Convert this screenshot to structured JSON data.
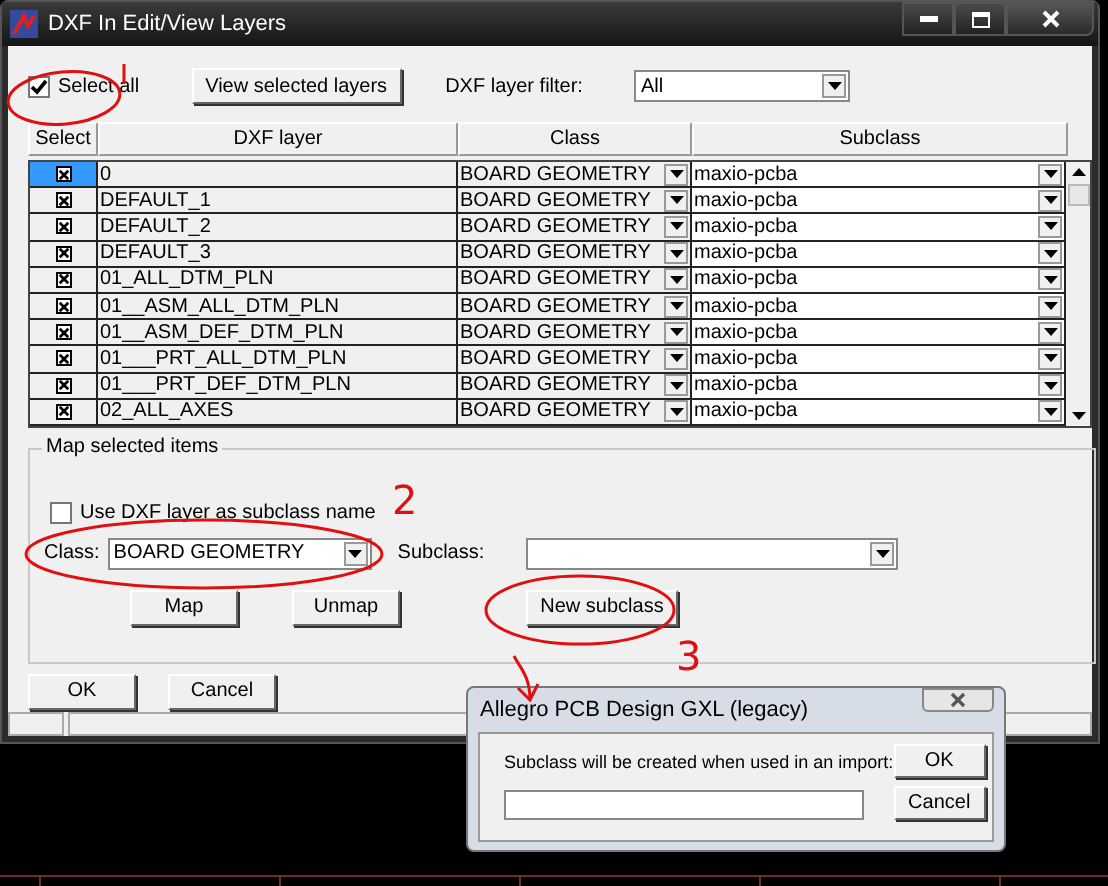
{
  "window": {
    "title": "DXF In Edit/View Layers"
  },
  "toolbar": {
    "select_all": {
      "label": "Select all",
      "checked": true
    },
    "view_button": "View selected layers",
    "filter_label": "DXF layer filter:",
    "filter_value": "All"
  },
  "table": {
    "columns": [
      "Select",
      "DXF layer",
      "Class",
      "Subclass"
    ],
    "rows": [
      {
        "selected": true,
        "checked": true,
        "layer": "0",
        "class": "BOARD GEOMETRY",
        "subclass": "maxio-pcba"
      },
      {
        "selected": false,
        "checked": true,
        "layer": "DEFAULT_1",
        "class": "BOARD GEOMETRY",
        "subclass": "maxio-pcba"
      },
      {
        "selected": false,
        "checked": true,
        "layer": "DEFAULT_2",
        "class": "BOARD GEOMETRY",
        "subclass": "maxio-pcba"
      },
      {
        "selected": false,
        "checked": true,
        "layer": "DEFAULT_3",
        "class": "BOARD GEOMETRY",
        "subclass": "maxio-pcba"
      },
      {
        "selected": false,
        "checked": true,
        "layer": "01_ALL_DTM_PLN",
        "class": "BOARD GEOMETRY",
        "subclass": "maxio-pcba"
      },
      {
        "selected": false,
        "checked": true,
        "layer": "01__ASM_ALL_DTM_PLN",
        "class": "BOARD GEOMETRY",
        "subclass": "maxio-pcba"
      },
      {
        "selected": false,
        "checked": true,
        "layer": "01__ASM_DEF_DTM_PLN",
        "class": "BOARD GEOMETRY",
        "subclass": "maxio-pcba"
      },
      {
        "selected": false,
        "checked": true,
        "layer": "01___PRT_ALL_DTM_PLN",
        "class": "BOARD GEOMETRY",
        "subclass": "maxio-pcba"
      },
      {
        "selected": false,
        "checked": true,
        "layer": "01___PRT_DEF_DTM_PLN",
        "class": "BOARD GEOMETRY",
        "subclass": "maxio-pcba"
      },
      {
        "selected": false,
        "checked": true,
        "layer": "02_ALL_AXES",
        "class": "BOARD GEOMETRY",
        "subclass": "maxio-pcba"
      }
    ]
  },
  "map_group": {
    "title": "Map selected items",
    "use_layer": {
      "label": "Use DXF layer as subclass name",
      "checked": false
    },
    "class_label": "Class:",
    "class_value": "BOARD GEOMETRY",
    "subclass_label": "Subclass:",
    "buttons": [
      "Map",
      "Unmap",
      "New subclass"
    ]
  },
  "footer_buttons": [
    "OK",
    "Cancel"
  ],
  "popup": {
    "title": "Allegro PCB Design GXL (legacy)",
    "message": "Subclass will be created when used in an import:",
    "buttons": [
      "OK",
      "Cancel"
    ]
  },
  "annotations": [
    "2",
    "3"
  ]
}
